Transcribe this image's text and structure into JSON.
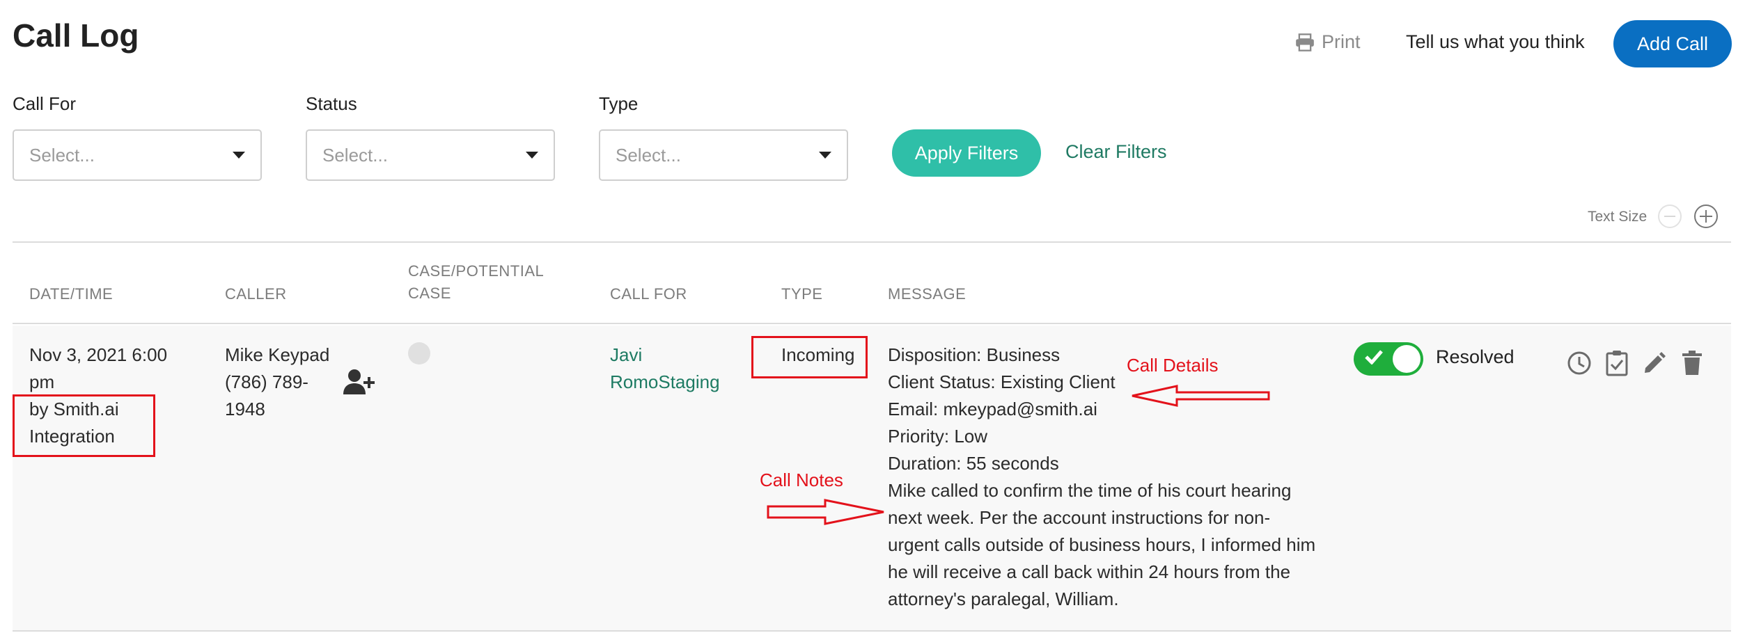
{
  "header": {
    "title": "Call Log",
    "print_label": "Print",
    "feedback_label": "Tell us what you think",
    "add_call_label": "Add Call"
  },
  "filters": {
    "call_for": {
      "label": "Call For",
      "placeholder": "Select..."
    },
    "status": {
      "label": "Status",
      "placeholder": "Select..."
    },
    "type": {
      "label": "Type",
      "placeholder": "Select..."
    },
    "apply_label": "Apply Filters",
    "clear_label": "Clear Filters"
  },
  "text_size": {
    "label": "Text Size"
  },
  "table": {
    "columns": [
      "DATE/TIME",
      "CALLER",
      "CASE/POTENTIAL",
      "CASE",
      "CALL FOR",
      "TYPE",
      "MESSAGE"
    ],
    "rows": [
      {
        "datetime_line1": "Nov 3, 2021 6:00",
        "datetime_line2": "pm",
        "by_line1": "by Smith.ai",
        "by_line2": "Integration",
        "caller_name": "Mike Keypad",
        "caller_phone_line1": "(786) 789-",
        "caller_phone_line2": "1948",
        "call_for_line1": "Javi",
        "call_for_line2": "RomoStaging",
        "type": "Incoming",
        "message_details": [
          "Disposition: Business",
          "Client Status: Existing Client",
          "Email: mkeypad@smith.ai",
          "Priority: Low",
          "Duration: 55 seconds"
        ],
        "message_notes": [
          "Mike called to confirm the time of his court hearing",
          "next week. Per the account instructions for non-",
          "urgent calls outside of business hours, I informed him",
          "he will receive a call back within 24 hours from the",
          "attorney's paralegal, William."
        ],
        "status": "Resolved"
      }
    ]
  },
  "annotations": {
    "call_details": "Call Details",
    "call_notes": "Call Notes"
  },
  "colors": {
    "primary_blue": "#0a6fc2",
    "apply_teal": "#2fbfa8",
    "link_green": "#1e7b63",
    "toggle_green": "#1fae3c",
    "annotation_red": "#e3121b"
  },
  "icons": [
    "printer-icon",
    "chevron-down-icon",
    "minus-circle-icon",
    "plus-circle-icon",
    "add-person-icon",
    "check-icon",
    "history-icon",
    "clipboard-check-icon",
    "pencil-icon",
    "trash-icon"
  ]
}
